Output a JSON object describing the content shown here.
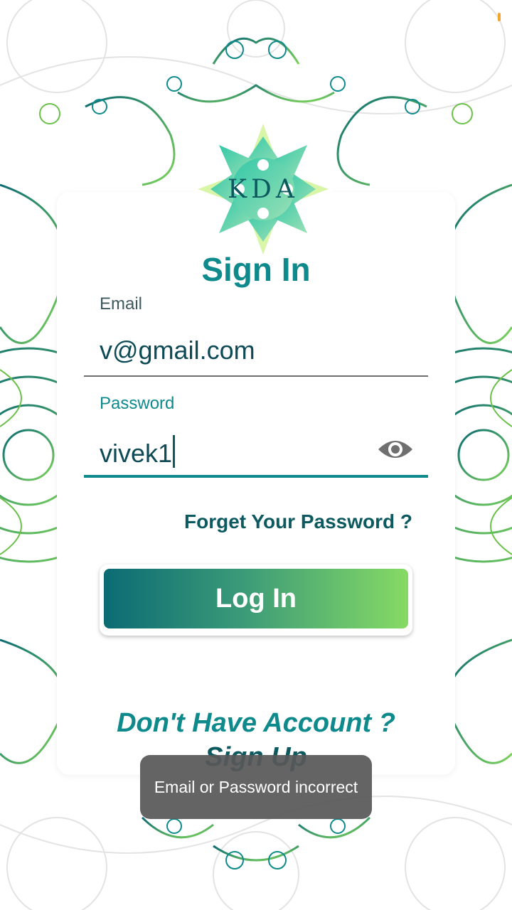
{
  "screen": {
    "title": "Sign In",
    "logo_text": "KDA"
  },
  "form": {
    "email_label": "Email",
    "email_value": "v@gmail.com",
    "password_label": "Password",
    "password_value": "vivek1",
    "password_toggle_icon": "eye-icon"
  },
  "links": {
    "forgot": "Forget Your Password ?",
    "no_account": "Don't Have Account ?",
    "signup": "Sign Up"
  },
  "buttons": {
    "login": "Log In"
  },
  "toast": {
    "message": "Email or Password incorrect"
  },
  "colors": {
    "primary": "#0f8a8c",
    "dark": "#0d5960",
    "gradient_start": "#0b6b73",
    "gradient_end": "#86da64"
  }
}
